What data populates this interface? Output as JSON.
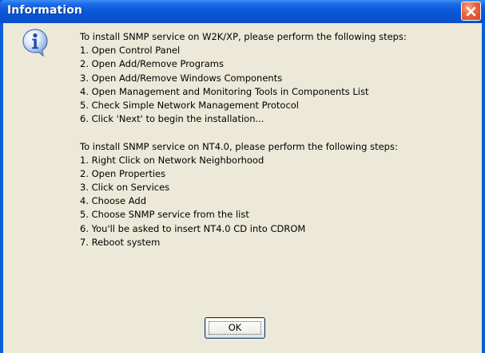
{
  "window": {
    "title": "Information"
  },
  "icons": {
    "info": "info-icon",
    "close": "close-icon"
  },
  "colors": {
    "titlebar": "#0a54d3",
    "close_button": "#e0582e",
    "client_bg": "#ece9d8"
  },
  "message": {
    "lines": [
      "To install SNMP service on W2K/XP, please perform the following steps:",
      "1. Open Control Panel",
      "2. Open Add/Remove Programs",
      "3. Open Add/Remove Windows Components",
      "4. Open Management and Monitoring Tools in Components List",
      "5. Check Simple Network Management Protocol",
      "6. Click 'Next' to begin the installation...",
      "",
      "To install SNMP service on NT4.0, please perform the following steps:",
      "1. Right Click on Network Neighborhood",
      "2. Open Properties",
      "3. Click on Services",
      "4. Choose Add",
      "5. Choose SNMP service from the list",
      "6. You'll be asked to insert NT4.0 CD into CDROM",
      "7. Reboot system"
    ]
  },
  "buttons": {
    "ok_label": "OK"
  }
}
